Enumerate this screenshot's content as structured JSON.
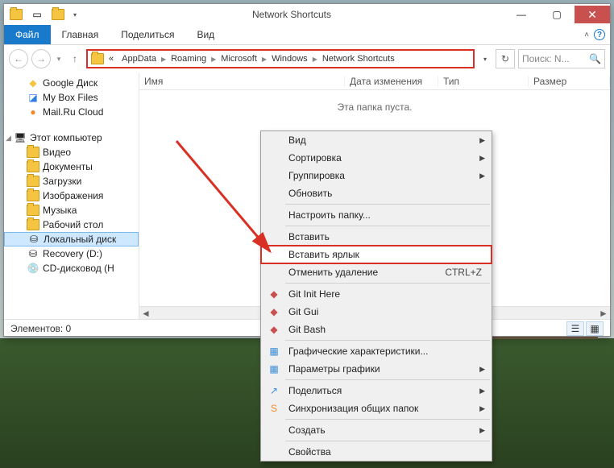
{
  "window": {
    "title": "Network Shortcuts"
  },
  "ribbon": {
    "file": "Файл",
    "tabs": [
      "Главная",
      "Поделиться",
      "Вид"
    ]
  },
  "breadcrumb": {
    "prefix": "«",
    "parts": [
      "AppData",
      "Roaming",
      "Microsoft",
      "Windows",
      "Network Shortcuts"
    ]
  },
  "search": {
    "placeholder": "Поиск: N..."
  },
  "columns": {
    "name": "Имя",
    "modified": "Дата изменения",
    "type": "Тип",
    "size": "Размер"
  },
  "empty_text": "Эта папка пуста.",
  "status": {
    "items": "Элементов: 0"
  },
  "tree": {
    "fav": [
      {
        "label": "Google Диск",
        "color": "#f5c542"
      },
      {
        "label": "My Box Files",
        "color": "#2f7de1"
      },
      {
        "label": "Mail.Ru Cloud",
        "color": "#f08a2a"
      }
    ],
    "pc_label": "Этот компьютер",
    "pc": [
      "Видео",
      "Документы",
      "Загрузки",
      "Изображения",
      "Музыка",
      "Рабочий стол",
      "Локальный диск",
      "Recovery (D:)",
      "CD-дисковод (H"
    ]
  },
  "context_menu": {
    "items": [
      {
        "label": "Вид",
        "submenu": true
      },
      {
        "label": "Сортировка",
        "submenu": true
      },
      {
        "label": "Группировка",
        "submenu": true
      },
      {
        "label": "Обновить"
      },
      {
        "sep": true
      },
      {
        "label": "Настроить папку..."
      },
      {
        "sep": true
      },
      {
        "label": "Вставить"
      },
      {
        "label": "Вставить ярлык",
        "highlight": true
      },
      {
        "label": "Отменить удаление",
        "shortcut": "CTRL+Z"
      },
      {
        "sep": true
      },
      {
        "label": "Git Init Here",
        "icon": "git"
      },
      {
        "label": "Git Gui",
        "icon": "git"
      },
      {
        "label": "Git Bash",
        "icon": "git"
      },
      {
        "sep": true
      },
      {
        "label": "Графические характеристики...",
        "icon": "intel"
      },
      {
        "label": "Параметры графики",
        "icon": "intel",
        "submenu": true
      },
      {
        "sep": true
      },
      {
        "label": "Поделиться",
        "icon": "share",
        "submenu": true
      },
      {
        "label": "Синхронизация общих папок",
        "icon": "sync",
        "submenu": true
      },
      {
        "sep": true
      },
      {
        "label": "Создать",
        "submenu": true
      },
      {
        "sep": true
      },
      {
        "label": "Свойства"
      }
    ]
  }
}
